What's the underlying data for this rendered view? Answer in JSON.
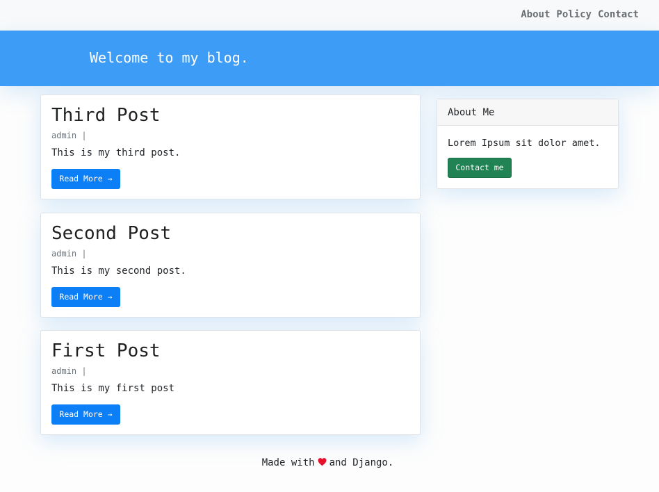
{
  "nav": {
    "links": [
      "About",
      "Policy",
      "Contact"
    ]
  },
  "masthead": {
    "title": "Welcome to my blog."
  },
  "posts": [
    {
      "title": "Third Post",
      "meta": "admin |",
      "excerpt": "This is my third post.",
      "read_more": "Read More →"
    },
    {
      "title": "Second Post",
      "meta": "admin |",
      "excerpt": "This is my second post.",
      "read_more": "Read More →"
    },
    {
      "title": "First Post",
      "meta": "admin |",
      "excerpt": "This is my first post",
      "read_more": "Read More →"
    }
  ],
  "sidebar": {
    "header": "About Me",
    "text": "Lorem Ipsum sit dolor amet.",
    "button": "Contact me"
  },
  "footer": {
    "prefix": "Made with",
    "icon": "heart-icon",
    "suffix": "and Django."
  },
  "colors": {
    "masthead": "#3d9df6",
    "primary_button": "#0d7ff6",
    "success_button": "#218253",
    "heart": "#e8112d"
  }
}
